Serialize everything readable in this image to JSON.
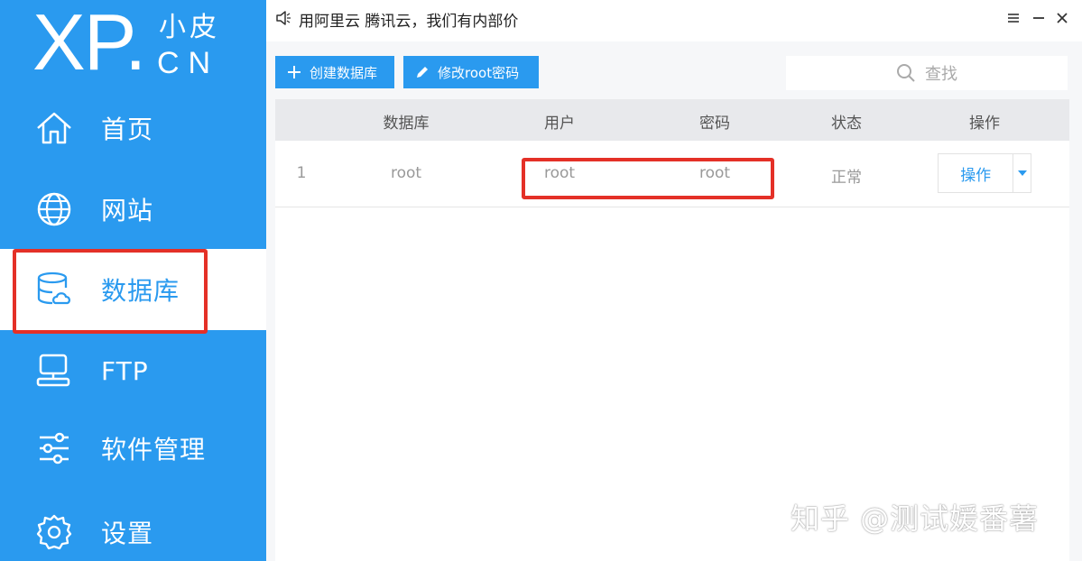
{
  "logo": {
    "main": "XP.",
    "cn": "小皮",
    "en": "CN"
  },
  "sidebar": {
    "items": [
      {
        "label": "首页",
        "icon": "home-icon"
      },
      {
        "label": "网站",
        "icon": "globe-icon"
      },
      {
        "label": "数据库",
        "icon": "database-icon",
        "active": true
      },
      {
        "label": "FTP",
        "icon": "server-icon"
      },
      {
        "label": "软件管理",
        "icon": "sliders-icon"
      },
      {
        "label": "设置",
        "icon": "gear-icon"
      }
    ]
  },
  "titlebar": {
    "notice": "用阿里云 腾讯云，我们有内部价"
  },
  "toolbar": {
    "create_label": "创建数据库",
    "modify_label": "修改root密码",
    "search_placeholder": "查找"
  },
  "table": {
    "headers": [
      "数据库",
      "用户",
      "密码",
      "状态",
      "操作"
    ],
    "rows": [
      {
        "index": "1",
        "database": "root",
        "user": "root",
        "password": "root",
        "status": "正常",
        "action": "操作"
      }
    ]
  },
  "watermark": "知乎 @测试媛番薯",
  "colors": {
    "accent": "#2a9aef",
    "highlight": "#e43027"
  }
}
